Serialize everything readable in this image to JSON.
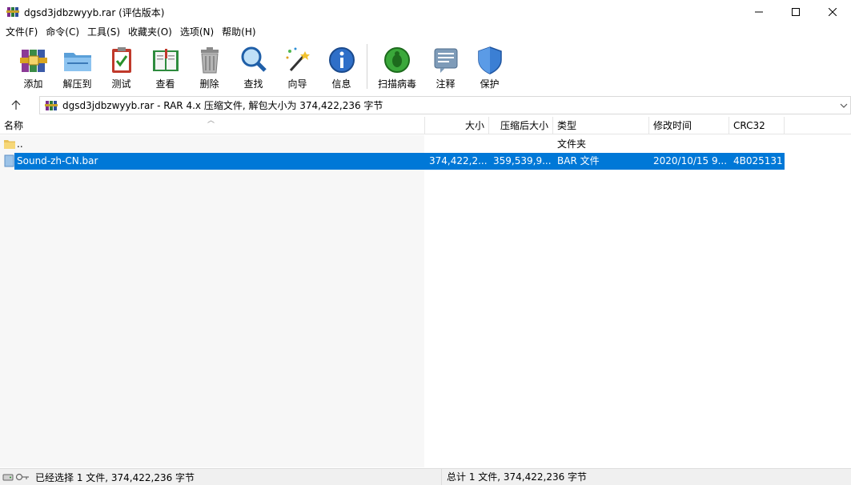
{
  "window": {
    "title": "dgsd3jdbzwyyb.rar (评估版本)",
    "app_icon": "winrar-books-icon"
  },
  "menu": [
    "文件(F)",
    "命令(C)",
    "工具(S)",
    "收藏夹(O)",
    "选项(N)",
    "帮助(H)"
  ],
  "toolbar": {
    "add": "添加",
    "extract": "解压到",
    "test": "测试",
    "view": "查看",
    "delete": "删除",
    "find": "查找",
    "wizard": "向导",
    "info": "信息",
    "virus_scan": "扫描病毒",
    "comment": "注释",
    "protect": "保护"
  },
  "address": {
    "path": "dgsd3jdbzwyyb.rar - RAR 4.x 压缩文件, 解包大小为 374,422,236 字节"
  },
  "columns": {
    "name": "名称",
    "size": "大小",
    "packed": "压缩后大小",
    "type": "类型",
    "modified": "修改时间",
    "crc": "CRC32"
  },
  "files": [
    {
      "name": "..",
      "size": "",
      "packed": "",
      "type": "文件夹",
      "modified": "",
      "crc": "",
      "icon": "folder-icon",
      "selected": false
    },
    {
      "name": "Sound-zh-CN.bar",
      "size": "374,422,2...",
      "packed": "359,539,9...",
      "type": "BAR 文件",
      "modified": "2020/10/15 9...",
      "crc": "4B025131",
      "icon": "file-icon",
      "selected": true
    }
  ],
  "status": {
    "left": "已经选择 1 文件, 374,422,236 字节",
    "right": "总计 1 文件, 374,422,236 字节"
  },
  "colors": {
    "selection": "#0078d7",
    "statusbar": "#f0f0f0"
  }
}
